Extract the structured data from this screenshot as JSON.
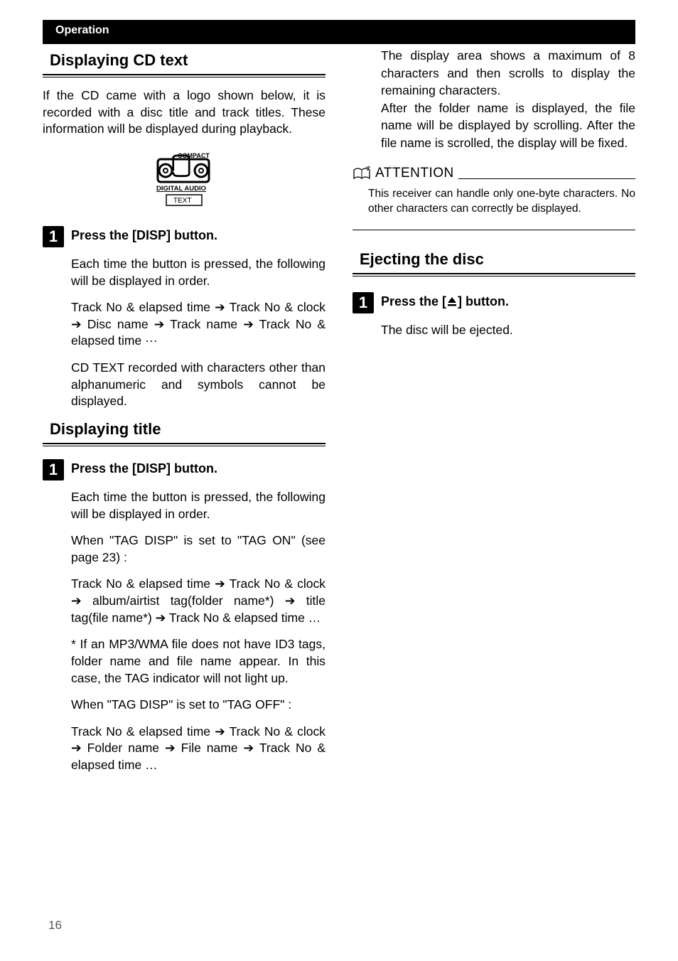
{
  "header": {
    "category": "Operation"
  },
  "pageNumber": "16",
  "left": {
    "section1": {
      "title": "Displaying CD text",
      "intro": "If the CD came with a logo shown below, it is recorded with a disc title and track titles. These information will be displayed during playback.",
      "logoAlt": "Compact Disc Digital Audio TEXT",
      "step": {
        "num": "1",
        "head": "Press the [DISP] button.",
        "p1": "Each time the button is pressed, the following will be displayed in order.",
        "p2": "Track No & elapsed time ➔ Track No & clock ➔ Disc name ➔ Track name ➔ Track No & elapsed time ···",
        "p3": "CD TEXT recorded with characters other than alphanumeric and symbols cannot be displayed."
      }
    },
    "section2": {
      "title": "Displaying title",
      "step": {
        "num": "1",
        "head": "Press the [DISP] button.",
        "p1": "Each time the button is pressed, the following will be displayed in order.",
        "p2": "When \"TAG DISP\" is set to \"TAG ON\" (see page 23) :",
        "p3": "Track No & elapsed time ➔ Track No & clock ➔ album/airtist tag(folder name*) ➔ title tag(file name*) ➔ Track No & elapsed time …",
        "p4": "* If an MP3/WMA file does not have ID3 tags, folder name and file name appear. In this case, the TAG indicator will not light up.",
        "p5": "When \"TAG DISP\" is set to \"TAG OFF\" :",
        "p6": "Track No & elapsed time ➔ Track No & clock ➔ Folder name ➔ File name ➔ Track No & elapsed time …"
      }
    }
  },
  "right": {
    "topPara": "The display area shows a maximum of 8 characters and then scrolls to display the remaining characters.\nAfter the folder name is displayed, the file name will be displayed by scrolling. After the file name is scrolled, the display will be fixed.",
    "attention": {
      "label": "ATTENTION",
      "body": "This receiver can handle only one-byte characters. No other characters can correctly be  displayed."
    },
    "section": {
      "title": "Ejecting the disc",
      "step": {
        "num": "1",
        "headPrefix": "Press the [",
        "headSuffix": "] button.",
        "p1": "The disc will be ejected."
      }
    }
  }
}
